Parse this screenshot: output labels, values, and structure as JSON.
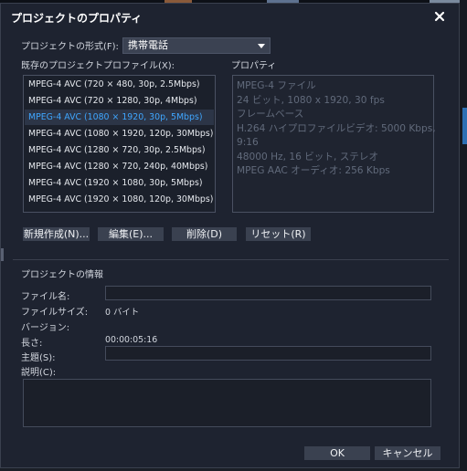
{
  "window": {
    "title": "プロジェクトのプロパティ"
  },
  "format": {
    "label": "プロジェクトの形式(F):",
    "selected": "携帯電話"
  },
  "profiles": {
    "label": "既存のプロジェクトプロファイル(X):",
    "items": [
      "MPEG-4 AVC (720 × 480, 30p, 2.5Mbps)",
      "MPEG-4 AVC (720 × 1280, 30p, 4Mbps)",
      "MPEG-4 AVC (1080 × 1920, 30p, 5Mbps)",
      "MPEG-4 AVC (1080 × 1920, 120p, 30Mbps)",
      "MPEG-4 AVC (1280 × 720, 30p, 2.5Mbps)",
      "MPEG-4 AVC (1280 × 720, 240p, 40Mbps)",
      "MPEG-4 AVC (1920 × 1080, 30p, 5Mbps)",
      "MPEG-4 AVC (1920 × 1080, 120p, 30Mbps)"
    ],
    "selected_index": 2
  },
  "properties": {
    "label": "プロパティ",
    "lines": [
      "MPEG-4 ファイル",
      "24 ビット, 1080 x 1920, 30 fps",
      "フレームベース",
      "H.264 ハイプロファイルビデオ: 5000 Kbps,",
      "9:16",
      "48000 Hz, 16 ビット, ステレオ",
      "MPEG AAC オーディオ: 256 Kbps"
    ]
  },
  "actions": {
    "new": "新規作成(N)...",
    "edit": "編集(E)...",
    "delete": "削除(D)",
    "reset": "リセット(R)"
  },
  "info": {
    "header": "プロジェクトの情報",
    "filename_label": "ファイル名:",
    "filename_value": "",
    "filesize_label": "ファイルサイズ:",
    "filesize_value": "0 バイト",
    "version_label": "バージョン:",
    "version_value": "",
    "length_label": "長さ:",
    "length_value": "00:00:05:16",
    "subject_label": "主題(S):",
    "subject_value": "",
    "description_label": "説明(C):",
    "description_value": ""
  },
  "footer": {
    "ok": "OK",
    "cancel": "キャンセル"
  },
  "colors": {
    "accent": "#3fa6ff",
    "dialog_bg": "#1e2330",
    "button_bg": "#3a4150"
  }
}
